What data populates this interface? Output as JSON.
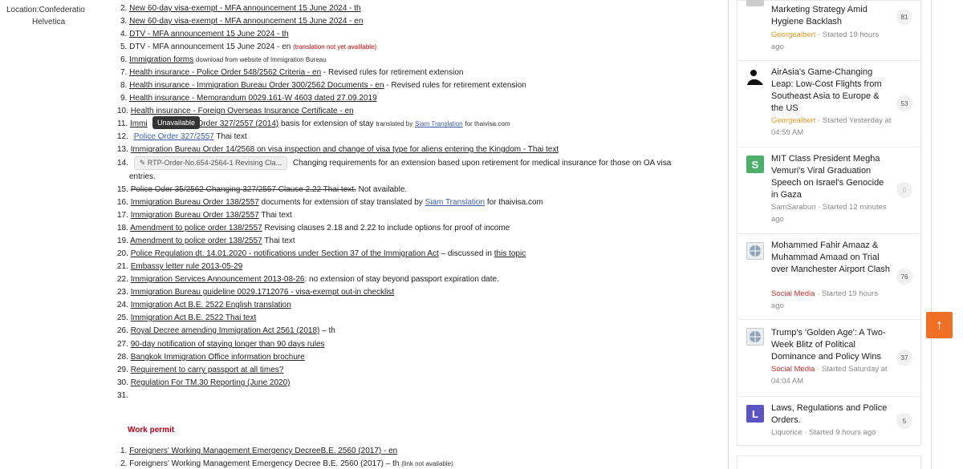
{
  "profile": {
    "clipped_text": "Confederatio",
    "location": "Location:Confederatio",
    "location_line2": "Helvetica"
  },
  "tooltip": "Unavailable",
  "list": {
    "i2": {
      "num": "2.",
      "link": "New 60-day visa-exempt - MFA announcement 15 June 2024 - th"
    },
    "i3": {
      "num": "3.",
      "link": "New 60-day visa-exempt - MFA announcement 15 June 2024 - en"
    },
    "i4": {
      "num": "4.",
      "link": "DTV - MFA announcement 15 June 2024 - th"
    },
    "i5": {
      "num": "5.",
      "text": "DTV - MFA announcement 15 June 2024 - en",
      "note": "(translation not yet availlable)"
    },
    "i6": {
      "num": "6.",
      "link": "Immigration forms",
      "small": "download from website of Immigration Bureau"
    },
    "i7": {
      "num": "7.",
      "link": "Health insurance - Police Order 548/2562 Criteria - en",
      "text": " - Revised rules for retirement extension"
    },
    "i8": {
      "num": "8.",
      "link": "Health insurance - Immigration Bureau Order 300/2562 Documents - en",
      "text": "  - Revised rules for retirement extension"
    },
    "i9": {
      "num": "9.",
      "link": "Health insurance - Memorandum 0029.161-W 4603 dated 27.09.2019"
    },
    "i10": {
      "num": "10.",
      "link": "Health insurance - Foreign Overseas Insurance Certificate - en"
    },
    "i11": {
      "num": "11.",
      "link_a": "Immi",
      "link_b": "au Order 327/2557 (2014)",
      "text": " basis for extension of stay",
      "small_a": "translated by",
      "blue": "Siam Translation",
      "small_b": "for thaivisa.com"
    },
    "i12": {
      "num": "12.",
      "blue": "Police Order 327/2557",
      "text": " Thai text"
    },
    "i13": {
      "num": "13.",
      "link": "Immigration Bureau Order 14/2568 on visa inspection and change of visa type for aliens entering the Kingdom - Thai text"
    },
    "i14": {
      "num": "14.",
      "attach": "RTP-Order-No.654-2564-1 Revising Cla...",
      "text": " Changing requirements for an extension based upon retirement for medical insurance for those on OA visa",
      "text2": "entries."
    },
    "i15": {
      "num": "15.",
      "strike": "Police Oder 35/2562 Changing 327/2557 Clause 2.22 Thai text.",
      "text": "  Not available."
    },
    "i16": {
      "num": "16.",
      "link": "Immigration Bureau Order 138/2557",
      "text": "  documents for extension of stay translated by ",
      "blue": "Siam Translation",
      "text2": " for thaivisa.com"
    },
    "i17": {
      "num": "17.",
      "link": "Immigration Bureau Order 138/2557",
      "text": " Thai text"
    },
    "i18": {
      "num": "18.",
      "link": "Amendment to police order 138/2557",
      "text": " Revising clauses 2.18 and 2.22 to include options for proof of income"
    },
    "i19": {
      "num": "19.",
      "link": "Amendment to police order 138/2557",
      "text": " Thai text"
    },
    "i20": {
      "num": "20.",
      "link": "Police Regulation dt. 14.01.2020 - notifications under Section 37 of the Immigration Act",
      "text": " – discussed in ",
      "link2": "this topic"
    },
    "i21": {
      "num": "21.",
      "link": "Embassy letter rule 2013-05-29"
    },
    "i22": {
      "num": "22.",
      "link": "Immigration Services Announcement 2013-08-26",
      "text": ": no extension of stay beyond passport expiration date."
    },
    "i23": {
      "num": "23.",
      "link": "Immigration Bureau guideline 0029.1712076 - visa-exempt out-in checklist"
    },
    "i24": {
      "num": "24.",
      "link": "Immigration Act B.E. 2522 English translation"
    },
    "i25": {
      "num": "25.",
      "link": "Immigration Act B.E. 2522 Thai text"
    },
    "i26": {
      "num": "26.",
      "link": "Royal Decree amending Immigration Act 2561 (2018)",
      "text": " – th"
    },
    "i27": {
      "num": "27.",
      "link": "90-day notification of staying longer than 90 days rules"
    },
    "i28": {
      "num": "28.",
      "link": "Bangkok Immigration Office information brochure"
    },
    "i29": {
      "num": "29.",
      "link": "Requirement to carry passport at all times?"
    },
    "i30": {
      "num": "30.",
      "link": "Regulation For TM.30 Reporting (June 2020)"
    },
    "i31": {
      "num": "31."
    }
  },
  "work_permit": {
    "title": "Work permit",
    "w1": {
      "num": "1.",
      "link": "Foreigners' Working Management Emergency DecreeB.E. 2560 (2017) - en"
    },
    "w2": {
      "num": "2.",
      "text": "Foreigners' Working Management Emergency Decree B.E. 2560 (2017) – th",
      "small": "(link not available)"
    }
  },
  "sidebar": {
    "topics": [
      {
        "title_partial": "Marketing Strategy Amid Hygiene Backlash",
        "author": "Georgealbert",
        "meta": " · Started 19 hours ago",
        "count": "81"
      },
      {
        "title": "AirAsia's Game-Changing Leap: Low-Cost Flights from Southeast Asia to Europe & the US",
        "author": "Georgealbert",
        "meta": " · Started Yesterday at 04:59 AM",
        "count": "53"
      },
      {
        "title": "MIT Class President Megha Vemuri's Viral Graduation Speech on Israel's Genocide in Gaza",
        "author": "SamSaraburi",
        "meta": " · Started 12 minutes ago",
        "count": "0",
        "avatar_letter": "S"
      },
      {
        "title": "Mohammed Fahir Amaaz & Muhammad Amaad on Trial over Manchester Airport Clash",
        "author": "Social Media",
        "meta": " · Started 19 hours ago",
        "count": "76"
      },
      {
        "title": "Trump's 'Golden Age': A Two-Week Blitz of Political Dominance and Policy Wins",
        "author": "Social Media",
        "meta": " · Started Saturday at 04:04 AM",
        "count": "37"
      },
      {
        "title": "Laws, Regulations and Police Orders.",
        "author": "Liquorice",
        "meta": " · Started 9 hours ago",
        "count": "5",
        "avatar_letter": "L"
      }
    ]
  },
  "colors": {
    "accent_orange": "#f07025",
    "author_orange": "#e49a25",
    "author_red": "#d32d2d",
    "section_red": "#c0001a",
    "avatar_green": "#4caf6a",
    "avatar_purple": "#5b55c4"
  },
  "icons": {
    "scroll_top": "arrow-up-icon",
    "attachment": "paperclip-icon"
  },
  "scroll_top_glyph": "↑"
}
